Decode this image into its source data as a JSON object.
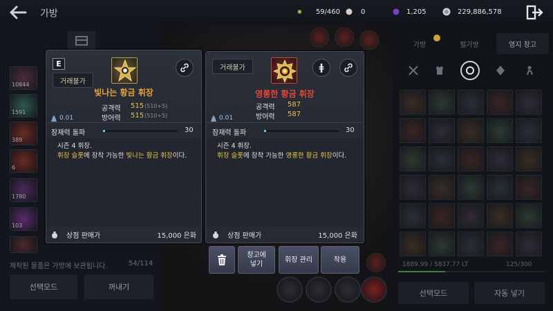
{
  "header": {
    "title": "가방",
    "currencies": [
      {
        "icon": "green-gem-icon",
        "value": "59/460"
      },
      {
        "icon": "pearl-icon",
        "value": "0"
      },
      {
        "icon": "purple-orb-icon",
        "value": "1,205"
      },
      {
        "icon": "silver-coin-icon",
        "value": "229,886,578"
      }
    ]
  },
  "left_panel": {
    "slot_counts": [
      "10844",
      "1591",
      "389",
      "6",
      "1780",
      "103"
    ],
    "footer_text": "제작된 물품은 가방에 보관됩니다.",
    "capacity": "54/114",
    "select_mode_label": "선택모드",
    "take_out_label": "꺼내기"
  },
  "right_panel": {
    "tabs": [
      "가방",
      "펄가방",
      "영지 창고"
    ],
    "weight": "1889.99 / 5837.77 LT",
    "weight_ratio": 0.32,
    "capacity": "125/300",
    "select_mode_label": "선택모드",
    "auto_store_label": "자동 넣기"
  },
  "card_left": {
    "grade": "E",
    "trade_label": "거래불가",
    "item_name": "빛나는 황금 휘장",
    "name_color": "#e8a33a",
    "stats": [
      {
        "label": "공격력",
        "value": "515",
        "bonus": "(510+5)"
      },
      {
        "label": "방어력",
        "value": "515",
        "bonus": "(510+5)"
      }
    ],
    "weight": "0.01",
    "potential_label": "잠재력 돌파",
    "potential_value": "30",
    "potential_ratio": 0.0,
    "desc_line1": "시즌 4 휘장.",
    "desc_hl1": "휘장 슬롯",
    "desc_mid": "에 장착 가능한 ",
    "desc_hl2": "빛나는 황금 휘장",
    "desc_end": "이다.",
    "price_label": "상점 판매가",
    "price_value": "15,000 은화"
  },
  "card_right": {
    "trade_label": "거래불가",
    "item_name": "영롱한 황금 휘장",
    "name_color": "#e8463a",
    "stats": [
      {
        "label": "공격력",
        "value": "587"
      },
      {
        "label": "방어력",
        "value": "587"
      }
    ],
    "weight": "0.01",
    "potential_label": "잠재력 돌파",
    "potential_value": "30",
    "potential_ratio": 0.0,
    "desc_line1": "시즌 4 휘장.",
    "desc_hl1": "휘장 슬롯",
    "desc_mid": "에 장착 가능한 ",
    "desc_hl2": "영롱한 황금 휘장",
    "desc_end": "이다.",
    "price_label": "상점 판매가",
    "price_value": "15,000 은화"
  },
  "actions": {
    "store_label": "창고에\n넣기",
    "emblem_manage_label": "휘장 관리",
    "equip_label": "착용"
  }
}
